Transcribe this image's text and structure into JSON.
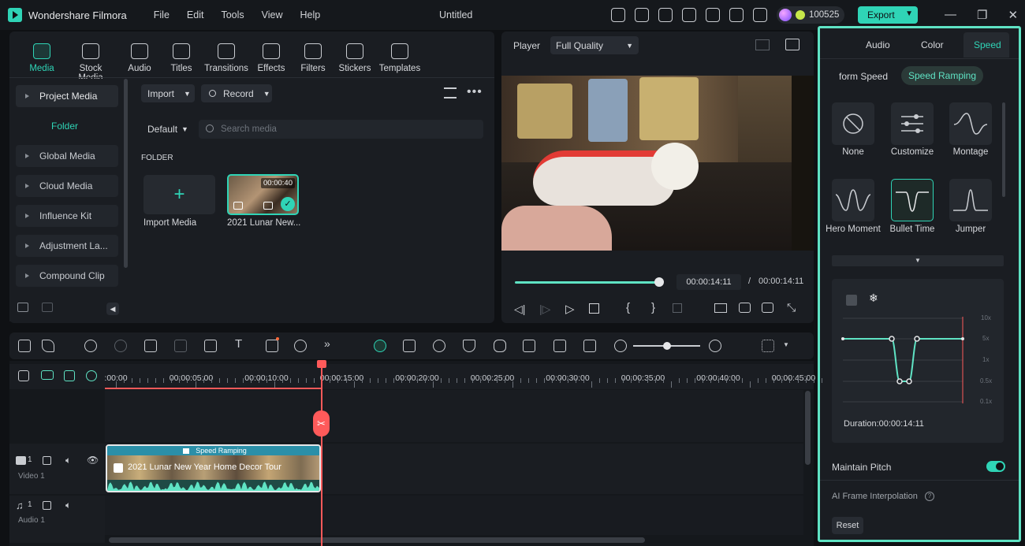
{
  "app": {
    "name": "Wondershare Filmora",
    "document_title": "Untitled"
  },
  "menu": [
    "File",
    "Edit",
    "Tools",
    "View",
    "Help"
  ],
  "header": {
    "credits": "100525",
    "export_label": "Export"
  },
  "media_tabs": [
    {
      "label": "Media",
      "icon": "media-icon",
      "active": true
    },
    {
      "label": "Stock Media",
      "icon": "stock-media-icon"
    },
    {
      "label": "Audio",
      "icon": "music-note-icon"
    },
    {
      "label": "Titles",
      "icon": "titles-icon"
    },
    {
      "label": "Transitions",
      "icon": "transitions-icon"
    },
    {
      "label": "Effects",
      "icon": "effects-icon"
    },
    {
      "label": "Filters",
      "icon": "filters-icon"
    },
    {
      "label": "Stickers",
      "icon": "stickers-icon"
    },
    {
      "label": "Templates",
      "icon": "templates-icon"
    }
  ],
  "sidebar": {
    "project_media": "Project Media",
    "folder": "Folder",
    "items": [
      "Global Media",
      "Cloud Media",
      "Influence Kit",
      "Adjustment La...",
      "Compound Clip"
    ]
  },
  "media_panel": {
    "import_label": "Import",
    "record_label": "Record",
    "sort_label": "Default",
    "search_placeholder": "Search media",
    "folder_heading": "FOLDER",
    "import_media_label": "Import Media",
    "clip_name": "2021 Lunar New...",
    "clip_duration": "00:00:40"
  },
  "player": {
    "label": "Player",
    "quality": "Full Quality",
    "current_time": "00:00:14:11",
    "separator": "/",
    "total_time": "00:00:14:11",
    "progress": 1.0
  },
  "right_panel": {
    "tabs": [
      "Audio",
      "Color",
      "Speed"
    ],
    "active_tab": "Speed",
    "subtabs": [
      "form Speed",
      "Speed Ramping"
    ],
    "active_subtab": "Speed Ramping",
    "presets": [
      {
        "label": "None",
        "icon": "none-icon"
      },
      {
        "label": "Customize",
        "icon": "customize-sliders-icon"
      },
      {
        "label": "Montage",
        "icon": "montage-curve-icon"
      },
      {
        "label": "Hero Moment",
        "icon": "hero-moment-curve-icon"
      },
      {
        "label": "Bullet Time",
        "icon": "bullet-time-curve-icon",
        "selected": true
      },
      {
        "label": "Jumper",
        "icon": "jumper-curve-icon"
      }
    ],
    "graph_scale": [
      "10x",
      "5x",
      "1x",
      "0.5x",
      "0.1x"
    ],
    "duration_label": "Duration:00:00:14:11",
    "maintain_pitch": "Maintain Pitch",
    "maintain_pitch_on": true,
    "ai_frame": "AI Frame Interpolation",
    "reset_label": "Reset"
  },
  "timeline": {
    "ruler": [
      ":00:00",
      "00:00:05:00",
      "00:00:10:00",
      "00:00:15:00",
      "00:00:20:00",
      "00:00:25:00",
      "00:00:30:00",
      "00:00:35:00",
      "00:00:40:00",
      "00:00:45:00"
    ],
    "clip_badge": "Speed Ramping",
    "clip_title": "2021 Lunar New Year Home Decor Tour",
    "video_track": {
      "index": "1",
      "name": "Video 1"
    },
    "audio_track": {
      "index": "1",
      "name": "Audio 1"
    }
  },
  "colors": {
    "accent": "#2fd4b6",
    "playhead": "#ff5a5a",
    "highlight_border": "#5fe3c4"
  }
}
